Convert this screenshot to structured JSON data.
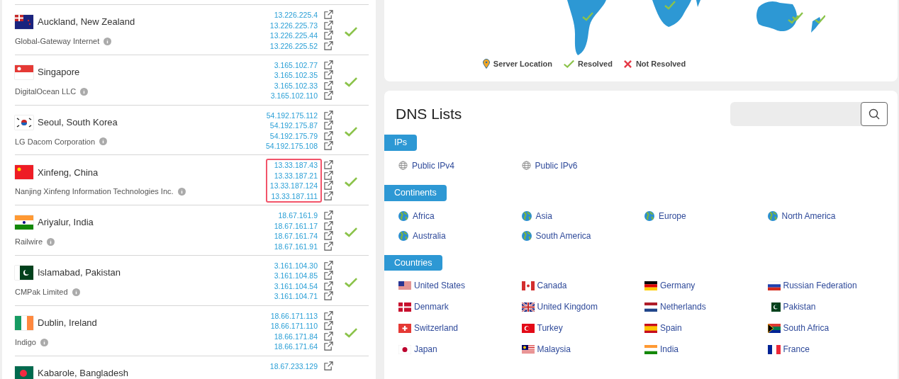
{
  "servers": [
    {
      "city": "Auckland, New Zealand",
      "provider": "Global-Gateway Internet",
      "ips": [
        "13.226.225.4",
        "13.226.225.73",
        "13.226.225.44",
        "13.226.225.52"
      ],
      "resolved": true,
      "highlighted": false
    },
    {
      "city": "Singapore",
      "provider": "DigitalOcean LLC",
      "ips": [
        "3.165.102.77",
        "3.165.102.35",
        "3.165.102.33",
        "3.165.102.110"
      ],
      "resolved": true,
      "highlighted": false
    },
    {
      "city": "Seoul, South Korea",
      "provider": "LG Dacom Corporation",
      "ips": [
        "54.192.175.112",
        "54.192.175.87",
        "54.192.175.79",
        "54.192.175.108"
      ],
      "resolved": true,
      "highlighted": false
    },
    {
      "city": "Xinfeng, China",
      "provider": "Nanjing Xinfeng Information Technologies Inc.",
      "ips": [
        "13.33.187.43",
        "13.33.187.21",
        "13.33.187.124",
        "13.33.187.111"
      ],
      "resolved": true,
      "highlighted": true
    },
    {
      "city": "Ariyalur, India",
      "provider": "Railwire",
      "ips": [
        "18.67.161.9",
        "18.67.161.17",
        "18.67.161.74",
        "18.67.161.91"
      ],
      "resolved": true,
      "highlighted": false
    },
    {
      "city": "Islamabad, Pakistan",
      "provider": "CMPak Limited",
      "ips": [
        "3.161.104.30",
        "3.161.104.85",
        "3.161.104.54",
        "3.161.104.71"
      ],
      "resolved": true,
      "highlighted": false
    },
    {
      "city": "Dublin, Ireland",
      "provider": "Indigo",
      "ips": [
        "18.66.171.113",
        "18.66.171.110",
        "18.66.171.84",
        "18.66.171.64"
      ],
      "resolved": true,
      "highlighted": false
    },
    {
      "city": "Kabarole, Bangladesh",
      "ips": [
        "18.67.233.129"
      ]
    }
  ],
  "map": {
    "legend": [
      "Server Location",
      "Resolved",
      "Not Resolved"
    ]
  },
  "dns_lists": {
    "title": "DNS Lists",
    "sections": [
      {
        "label": "IPs",
        "kind": "ip",
        "items": [
          "Public IPv4",
          "Public IPv6"
        ]
      },
      {
        "label": "Continents",
        "kind": "continent",
        "items": [
          "Africa",
          "Asia",
          "Europe",
          "North America",
          "Australia",
          "South America"
        ]
      },
      {
        "label": "Countries",
        "kind": "country",
        "items": [
          "United States",
          "Canada",
          "Germany",
          "Russian Federation",
          "Denmark",
          "United Kingdom",
          "Netherlands",
          "Pakistan",
          "Switzerland",
          "Turkey",
          "Spain",
          "South Africa",
          "Japan",
          "Malaysia",
          "India",
          "France"
        ]
      }
    ]
  }
}
